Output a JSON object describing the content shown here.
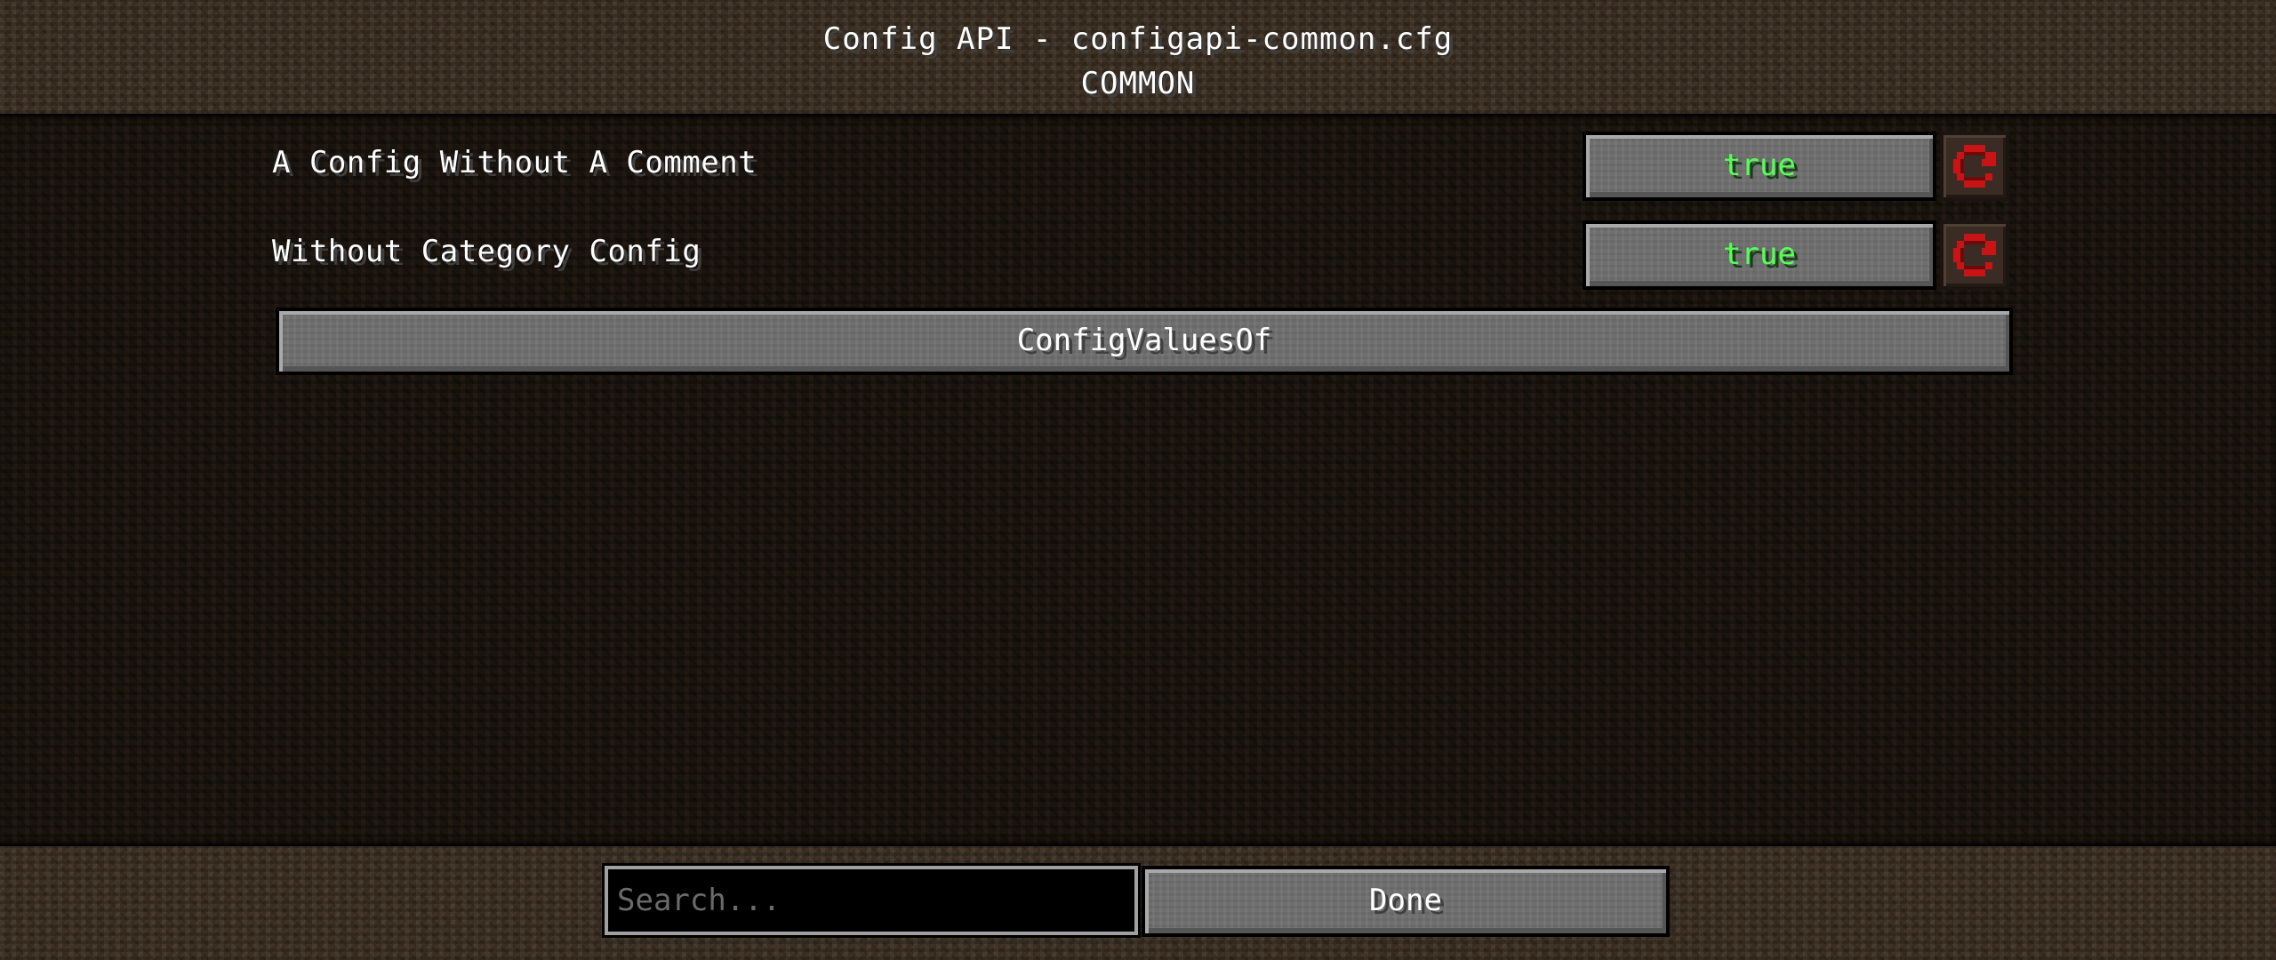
{
  "header": {
    "title": "Config API - configapi-common.cfg",
    "subtitle": "COMMON"
  },
  "entries": [
    {
      "label": "A Config Without A Comment",
      "value": "true",
      "value_color": "#55ff55",
      "reset_icon": "reset-arrow-icon"
    },
    {
      "label": "Without Category Config",
      "value": "true",
      "value_color": "#55ff55",
      "reset_icon": "reset-arrow-icon"
    }
  ],
  "category_button": {
    "label": "ConfigValuesOf"
  },
  "footer": {
    "search_placeholder": "Search...",
    "done_label": "Done"
  },
  "colors": {
    "reset_icon": "#c81414",
    "text": "#ffffff",
    "true_value": "#55ff55"
  }
}
